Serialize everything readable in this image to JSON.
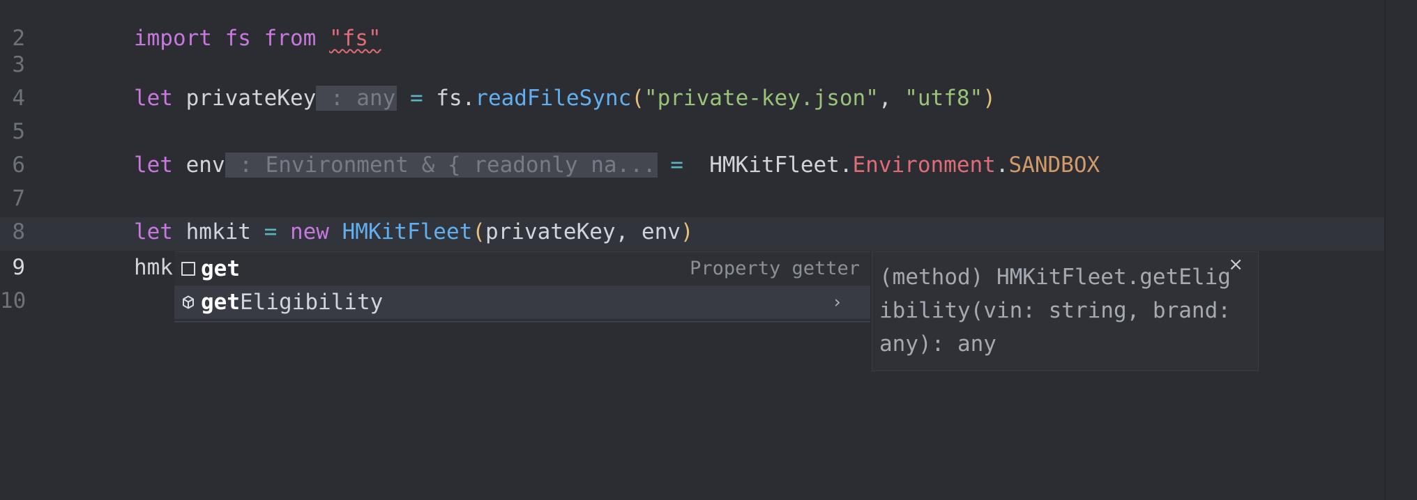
{
  "editor": {
    "lines": [
      {
        "number": "2",
        "tokens": [
          {
            "text": "import",
            "role": "keyword"
          },
          {
            "text": " ",
            "role": "space"
          },
          {
            "text": "fs",
            "role": "keyword"
          },
          {
            "text": " ",
            "role": "space"
          },
          {
            "text": "from",
            "role": "keyword"
          },
          {
            "text": " ",
            "role": "space"
          },
          {
            "text": "\"fs\"",
            "role": "string-error"
          }
        ]
      },
      {
        "number": "3",
        "tokens": []
      },
      {
        "number": "4",
        "tokens": [
          {
            "text": "let",
            "role": "keyword"
          },
          {
            "text": " privateKey",
            "role": "identifier"
          },
          {
            "text": " : any",
            "role": "hint"
          },
          {
            "text": " = ",
            "role": "operator"
          },
          {
            "text": "fs.",
            "role": "identifier"
          },
          {
            "text": "readFileSync",
            "role": "function"
          },
          {
            "text": "(",
            "role": "paren"
          },
          {
            "text": "\"private-key.json\"",
            "role": "string"
          },
          {
            "text": ", ",
            "role": "identifier"
          },
          {
            "text": "\"utf8\"",
            "role": "string"
          },
          {
            "text": ")",
            "role": "paren"
          }
        ]
      },
      {
        "number": "5",
        "tokens": []
      },
      {
        "number": "6",
        "tokens": [
          {
            "text": "let",
            "role": "keyword"
          },
          {
            "text": " env",
            "role": "identifier"
          },
          {
            "text": " : Environment & { readonly na...",
            "role": "hint"
          },
          {
            "text": " = ",
            "role": "operator"
          },
          {
            "text": " HMKitFleet.",
            "role": "identifier"
          },
          {
            "text": "Environment",
            "role": "property"
          },
          {
            "text": ".",
            "role": "identifier"
          },
          {
            "text": "SANDBOX",
            "role": "constant"
          }
        ]
      },
      {
        "number": "7",
        "tokens": []
      },
      {
        "number": "8",
        "tokens": [
          {
            "text": "let",
            "role": "keyword"
          },
          {
            "text": " hmkit",
            "role": "identifier"
          },
          {
            "text": " = ",
            "role": "operator"
          },
          {
            "text": "new",
            "role": "keyword"
          },
          {
            "text": " ",
            "role": "space"
          },
          {
            "text": "HMKitFleet",
            "role": "function"
          },
          {
            "text": "(",
            "role": "paren"
          },
          {
            "text": "privateKey, env",
            "role": "identifier"
          },
          {
            "text": ")",
            "role": "paren"
          }
        ]
      },
      {
        "number": "9",
        "active": true,
        "tokens": [
          {
            "text": "hmkit.",
            "role": "identifier"
          },
          {
            "text": "get",
            "role": "property-error"
          }
        ]
      },
      {
        "number": "10",
        "tokens": []
      }
    ]
  },
  "completion": {
    "items": [
      {
        "icon": "property-square-icon",
        "match": "get",
        "rest": "",
        "detail": "Property getter",
        "selected": false
      },
      {
        "icon": "method-cube-icon",
        "match": "get",
        "rest": "Eligibility",
        "detail": "",
        "selected": true,
        "expand_icon": "chevron-right-icon"
      }
    ]
  },
  "details": {
    "text": "(method) HMKitFleet.getEligibility(vin: string, brand: any): any",
    "close_label": "×"
  },
  "colors": {
    "background": "#2b2d33",
    "current_line": "#32343b",
    "keyword": "#c678dd",
    "function": "#61afef",
    "string": "#98c379",
    "property": "#e06c75",
    "constant": "#d19a66",
    "paren": "#e5c07b",
    "hint_background": "#44474f"
  }
}
